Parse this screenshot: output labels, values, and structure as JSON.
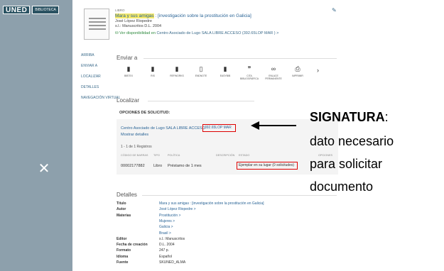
{
  "logo": {
    "brand": "UNED",
    "sub": "BIBLIOTECA"
  },
  "nav": [
    "ARRIBA",
    "ENVIAR A",
    "LOCALIZAR",
    "DETALLES",
    "NAVEGACIÓN VIRTUAL"
  ],
  "record": {
    "type": "LIBRO",
    "title_main": "Mara y sus amigas",
    "title_rest": " : [investigación sobre la prostitución en Galicia]",
    "author": "José López Riopedre",
    "pub": "s.l.: Manuscritos D.L. 2004",
    "avail_prefix": "Ver disponibilidad en",
    "avail_link": "Centro Asociado de Lugo  SALA LIBRE ACCESO (392.65LOP MAR )",
    "avail_arrow": ">"
  },
  "enviar": {
    "title": "Enviar a",
    "tools": [
      {
        "icon": "bibtex-icon",
        "glyph": "▮",
        "label": "BIBTEX"
      },
      {
        "icon": "ris-icon",
        "glyph": "▮",
        "label": "RIS"
      },
      {
        "icon": "refworks-icon",
        "glyph": "▮",
        "label": "REFWORKS"
      },
      {
        "icon": "endnote-icon",
        "glyph": "▯",
        "label": "ENDNOTE"
      },
      {
        "icon": "easybib-icon",
        "glyph": "▮",
        "label": "EASYBIB"
      },
      {
        "icon": "quote-icon",
        "glyph": "❞",
        "label": "CITA BIBLIOGRÁFICA"
      },
      {
        "icon": "link-icon",
        "glyph": "∞",
        "label": "ENLACE PERMANENTE"
      },
      {
        "icon": "print-icon",
        "glyph": "⎙",
        "label": "IMPRIMIR"
      }
    ],
    "next": "›"
  },
  "localizar": {
    "title": "Localizar",
    "options_label": "OPCIONES DE SOLICITUD:",
    "library": "Centro Asociado de Lugo  SALA LIBRE ACCESO",
    "signatura": "392.65LOP MAR",
    "more": "Mostrar detalles",
    "count": "1 - 1 de 1 Registros",
    "headers": [
      "CÓDIGO DE BARRAS",
      "TIPO",
      "POLÍTICA",
      "DESCRIPCIÓN",
      "ESTADO",
      "OPCIONES"
    ],
    "row": {
      "barcode": "00002177882",
      "tipo": "Libro",
      "politica": "Préstamo de 1 mes",
      "estado": "Ejemplar en su lugar (0 solicitudes)"
    }
  },
  "annotation": {
    "title": "SIGNATURA",
    "colon": ":",
    "lines": [
      "dato necesario",
      "para solicitar",
      "documento"
    ]
  },
  "detalles": {
    "title": "Detalles",
    "rows": [
      {
        "k": "Título",
        "v": "Mara y sus amigas : [investigación sobre la prostitución en Galicia]",
        "link": true
      },
      {
        "k": "Autor",
        "v": "José López Riopedre  >",
        "link": true
      },
      {
        "k": "Materias",
        "v": "Prostitución  >",
        "link": true
      },
      {
        "k": "",
        "v": "Mujeres  >",
        "link": true
      },
      {
        "k": "",
        "v": "Galicia  >",
        "link": true
      },
      {
        "k": "",
        "v": "Brasil  >",
        "link": true
      },
      {
        "k": "Editor",
        "v": "s.l.: Manuscritos",
        "link": false
      },
      {
        "k": "Fecha de creación",
        "v": "D.L. 2004",
        "link": false
      },
      {
        "k": "Formato",
        "v": "247 p.",
        "link": false
      },
      {
        "k": "Idioma",
        "v": "Español",
        "link": false
      },
      {
        "k": "Fuente",
        "v": "SKUNED_ALMA",
        "link": false
      }
    ]
  },
  "close_glyph": "✕",
  "colors": {
    "overlay": "#8da0ac",
    "link": "#2a6496",
    "highlight": "#d00000",
    "brand": "#2a5262"
  }
}
